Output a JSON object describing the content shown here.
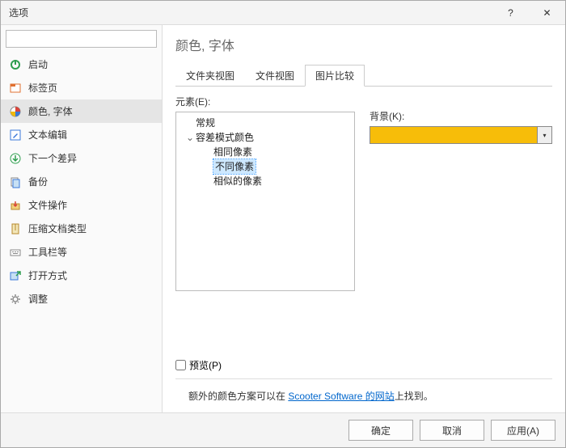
{
  "window": {
    "title": "选项",
    "help": "?",
    "close": "✕"
  },
  "sidebar": {
    "search_placeholder": "",
    "items": [
      {
        "label": "启动"
      },
      {
        "label": "标签页"
      },
      {
        "label": "颜色, 字体"
      },
      {
        "label": "文本编辑"
      },
      {
        "label": "下一个差异"
      },
      {
        "label": "备份"
      },
      {
        "label": "文件操作"
      },
      {
        "label": "压缩文档类型"
      },
      {
        "label": "工具栏等"
      },
      {
        "label": "打开方式"
      },
      {
        "label": "调整"
      }
    ]
  },
  "content": {
    "title": "颜色, 字体",
    "tabs": [
      "文件夹视图",
      "文件视图",
      "图片比较"
    ],
    "active_tab": 2,
    "element_label": "元素(E):",
    "background_label": "背景(K):",
    "tree": {
      "root": "常规",
      "group": "容差模式颜色",
      "children": [
        "相同像素",
        "不同像素",
        "相似的像素"
      ],
      "selected_index": 1
    },
    "bg_color": "#f7bd09",
    "preview_label": "预览(P)"
  },
  "footnote": {
    "prefix": "额外的颜色方案可以在 ",
    "link": "Scooter Software 的网站",
    "suffix": "上找到。"
  },
  "buttons": {
    "ok": "确定",
    "cancel": "取消",
    "apply": "应用(A)"
  }
}
